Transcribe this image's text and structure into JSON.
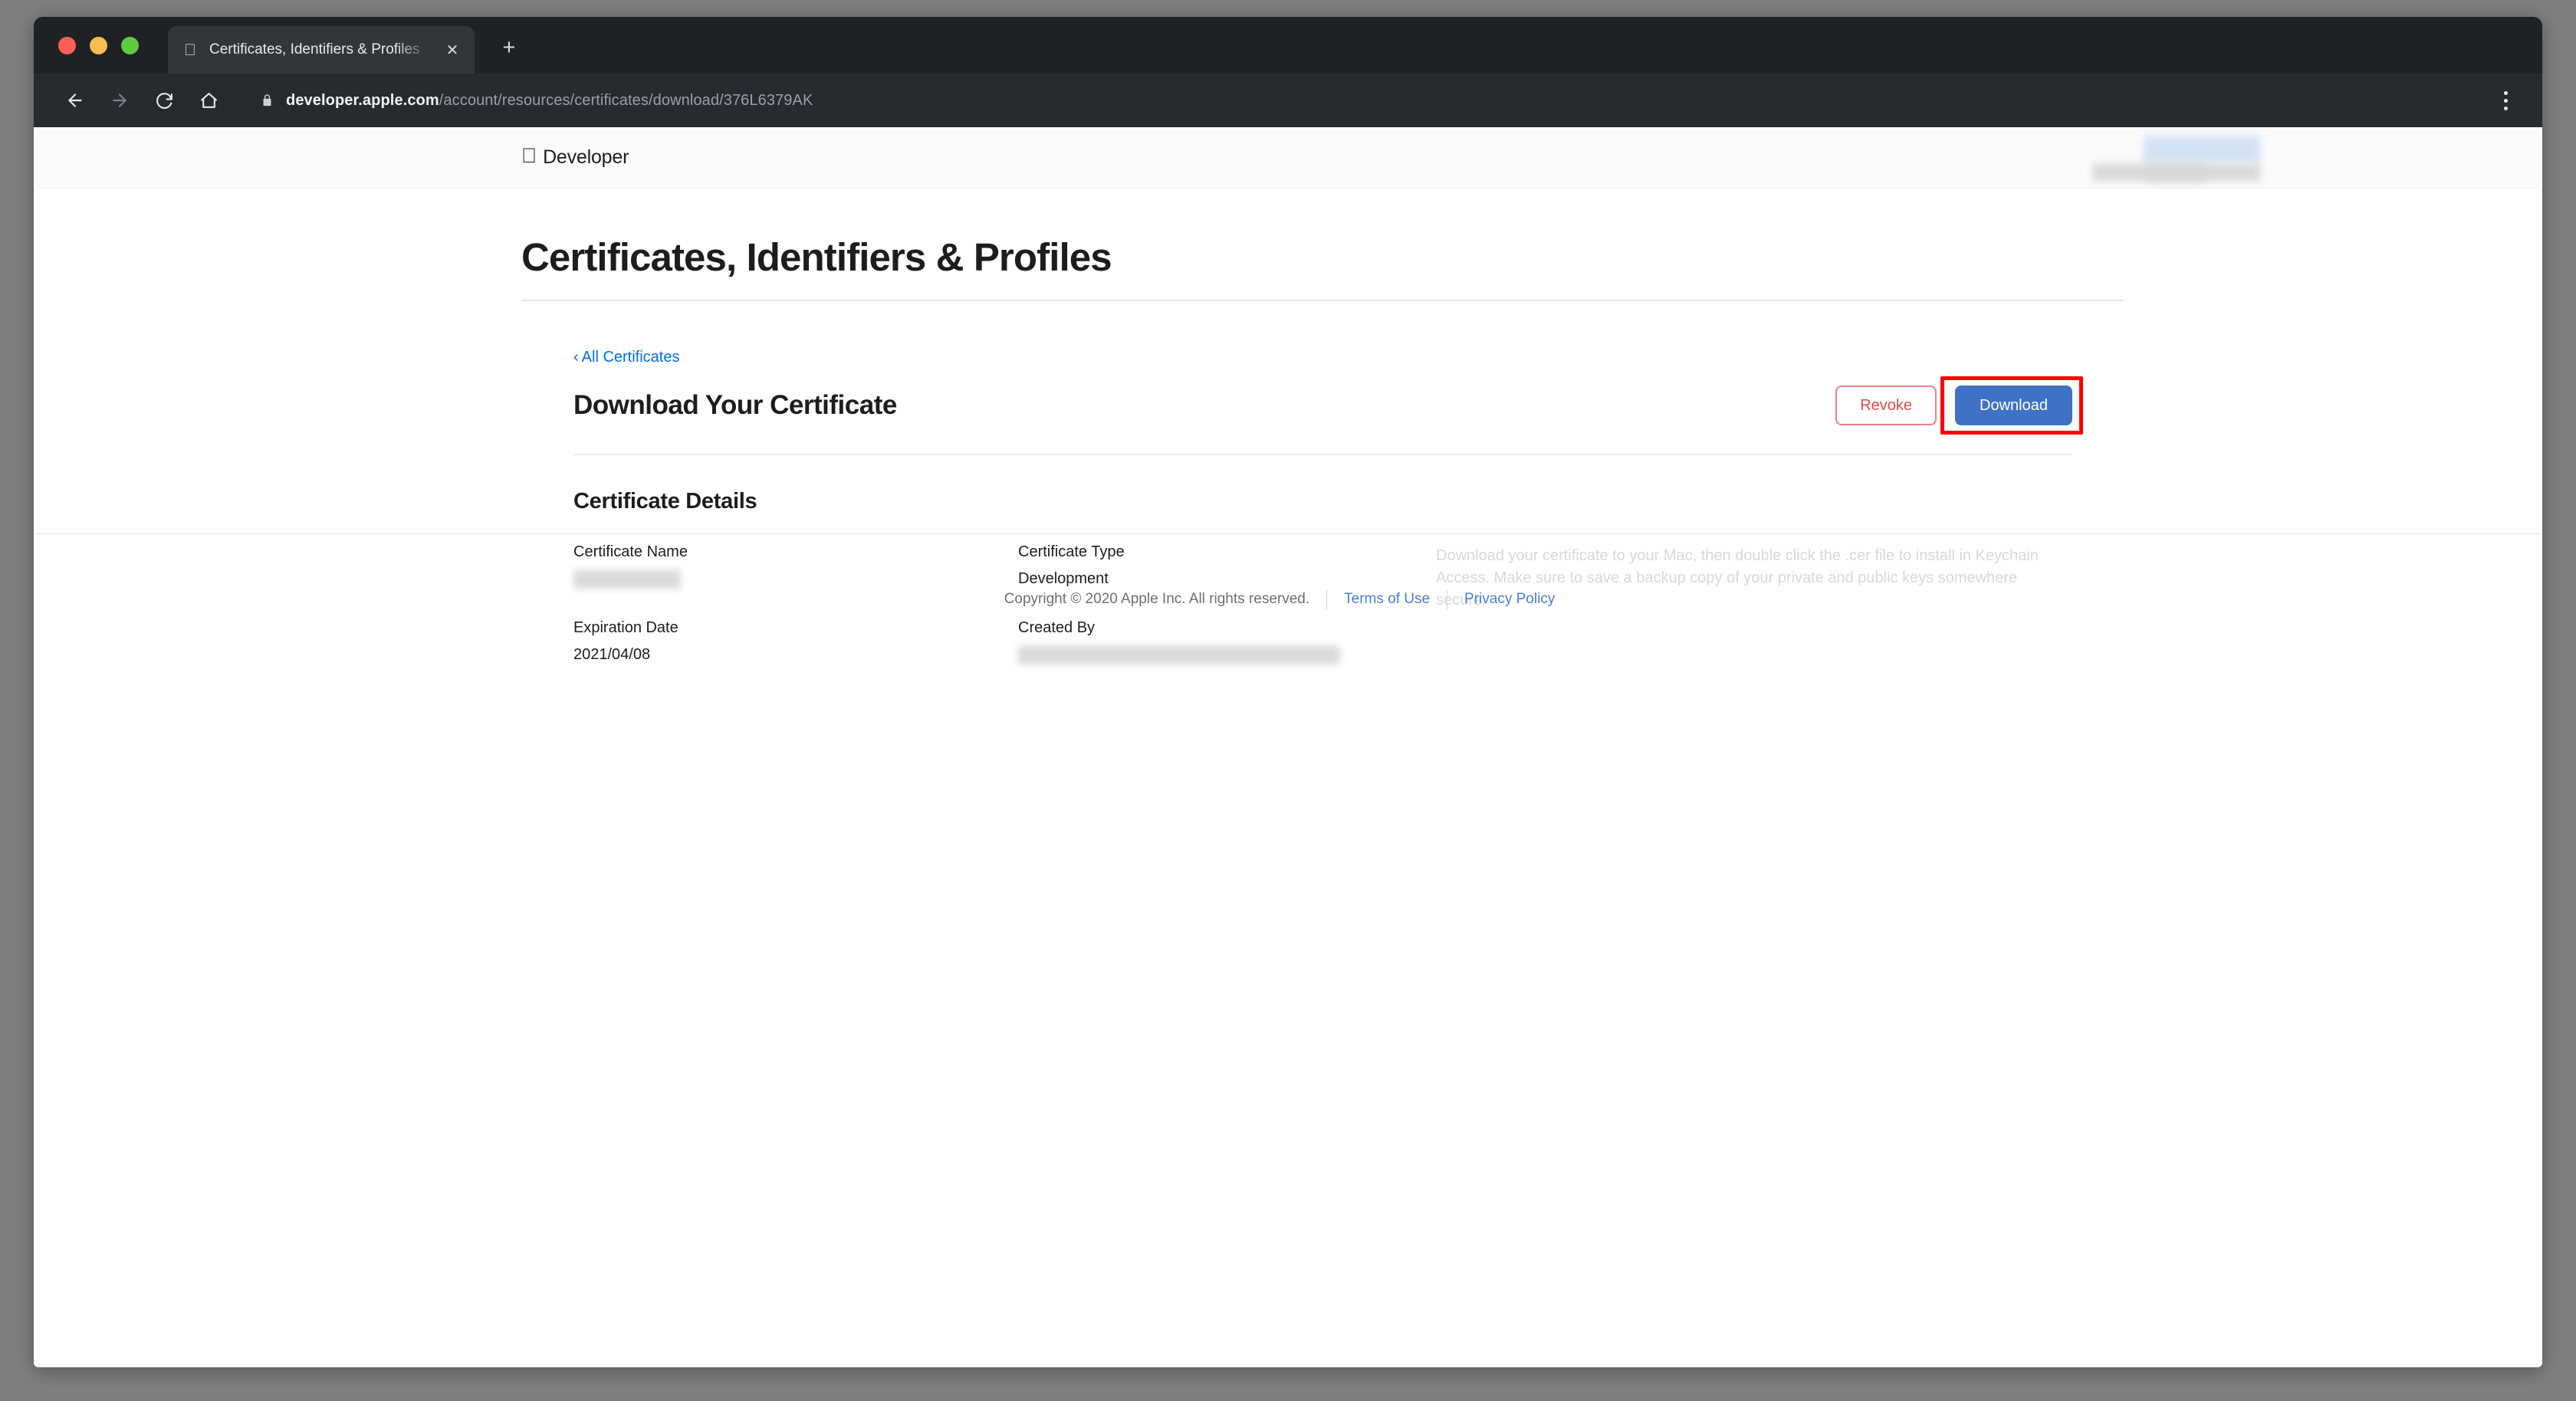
{
  "browser": {
    "tab": {
      "title": "Certificates, Identifiers & Profiles",
      "favicon": "apple-icon",
      "close_label": "✕"
    },
    "new_tab_label": "+",
    "toolbar": {
      "back_icon": "back-arrow-icon",
      "forward_icon": "forward-arrow-icon",
      "reload_icon": "reload-icon",
      "home_icon": "home-icon",
      "lock_icon": "lock-icon",
      "menu_icon": "three-dot-menu-icon",
      "url_host": "developer.apple.com",
      "url_path": "/account/resources/certificates/download/376L6379AK"
    }
  },
  "site_nav": {
    "logo_glyph": "",
    "logo_text": "Developer",
    "account_redacted": true
  },
  "page": {
    "title": "Certificates, Identifiers & Profiles",
    "breadcrumb": {
      "chevron": "‹",
      "label": "All Certificates"
    },
    "sub_title": "Download Your Certificate",
    "buttons": {
      "revoke": "Revoke",
      "download": "Download"
    },
    "annotation": {
      "target": "download-button",
      "color": "#ff0000"
    },
    "details": {
      "heading": "Certificate Details",
      "fields": [
        {
          "label": "Certificate Name",
          "value": "",
          "redacted": true,
          "wide": false
        },
        {
          "label": "Certificate Type",
          "value": "Development",
          "redacted": false,
          "wide": false
        },
        {
          "label": "Expiration Date",
          "value": "2021/04/08",
          "redacted": false,
          "wide": false
        },
        {
          "label": "Created By",
          "value": "",
          "redacted": true,
          "wide": true
        }
      ]
    },
    "help_text": "Download your certificate to your Mac, then double click the .cer file to install in Keychain Access. Make sure to save a backup copy of your private and public keys somewhere secure."
  },
  "footer": {
    "copyright": "Copyright © 2020 Apple Inc. All rights reserved.",
    "links": [
      {
        "label": "Terms of Use"
      },
      {
        "label": "Privacy Policy"
      }
    ]
  },
  "colors": {
    "accent_blue": "#3f72c4",
    "link_blue": "#0071e3",
    "revoke_red": "#e24a4a",
    "annotation_red": "#ff0000",
    "chrome_dark": "#202124"
  }
}
